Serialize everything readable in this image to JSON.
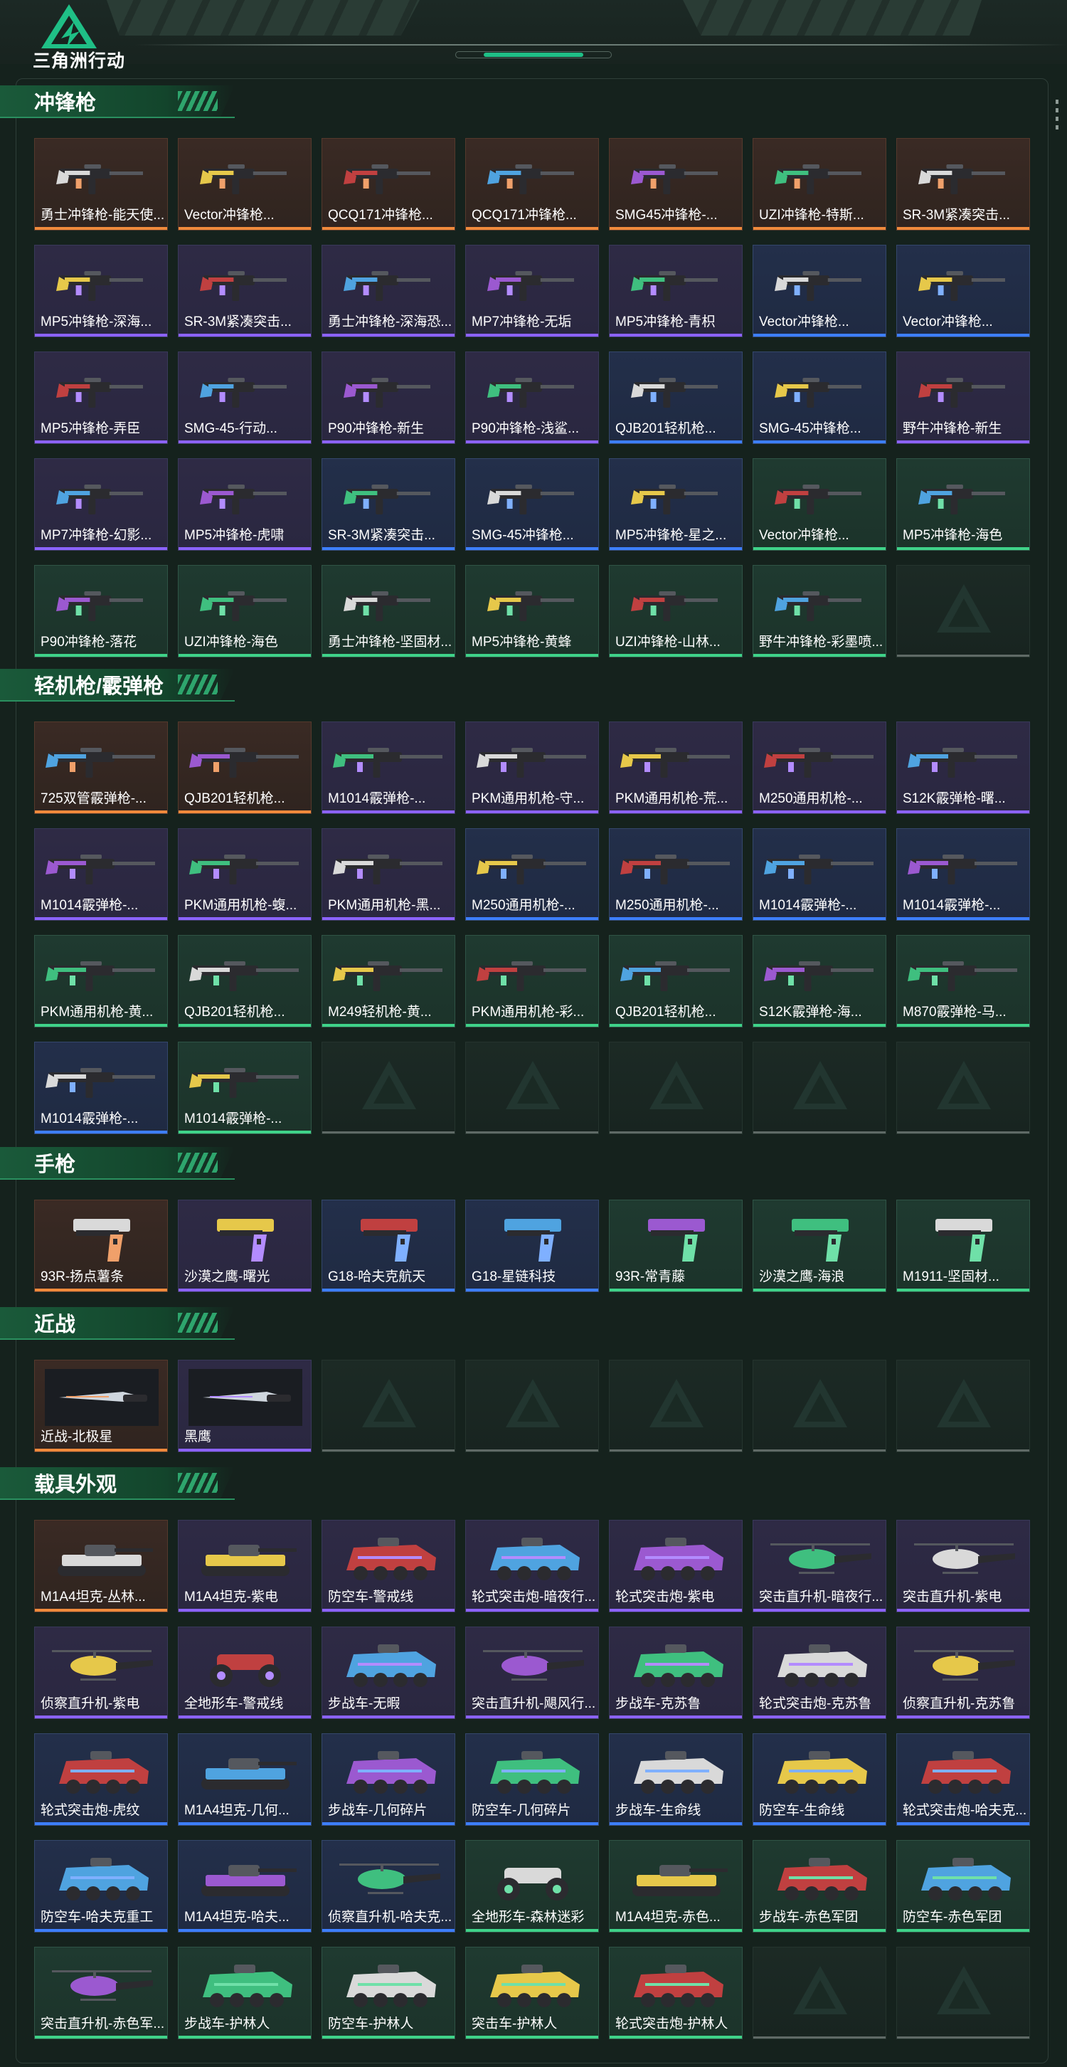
{
  "app": {
    "title": "三角洲行动",
    "logo_icon": "delta-logo-icon"
  },
  "colors": {
    "accent": "#1fbf86",
    "quality_orange": "#f08a3c",
    "quality_purple": "#8c63ff",
    "quality_blue": "#3d7fff",
    "quality_green": "#3fd389"
  },
  "sections": [
    {
      "title": "冲锋枪",
      "items": [
        {
          "label": "勇士冲锋枪-能天使...",
          "quality": "orange",
          "icon": "smg-icon"
        },
        {
          "label": "Vector冲锋枪...",
          "quality": "orange",
          "icon": "smg-icon"
        },
        {
          "label": "QCQ171冲锋枪...",
          "quality": "orange",
          "icon": "smg-icon"
        },
        {
          "label": "QCQ171冲锋枪...",
          "quality": "orange",
          "icon": "smg-icon"
        },
        {
          "label": "SMG45冲锋枪-...",
          "quality": "orange",
          "icon": "smg-icon"
        },
        {
          "label": "UZI冲锋枪-特斯...",
          "quality": "orange",
          "icon": "smg-icon"
        },
        {
          "label": "SR-3M紧凑突击...",
          "quality": "orange",
          "icon": "smg-icon"
        },
        {
          "label": "MP5冲锋枪-深海...",
          "quality": "purple",
          "icon": "smg-icon"
        },
        {
          "label": "SR-3M紧凑突击...",
          "quality": "purple",
          "icon": "smg-icon"
        },
        {
          "label": "勇士冲锋枪-深海恐...",
          "quality": "purple",
          "icon": "smg-icon"
        },
        {
          "label": "MP7冲锋枪-无垢",
          "quality": "purple",
          "icon": "smg-icon"
        },
        {
          "label": "MP5冲锋枪-青枳",
          "quality": "purple",
          "icon": "smg-icon"
        },
        {
          "label": "Vector冲锋枪...",
          "quality": "blue",
          "icon": "smg-icon"
        },
        {
          "label": "Vector冲锋枪...",
          "quality": "blue",
          "icon": "smg-icon"
        },
        {
          "label": "MP5冲锋枪-弄臣",
          "quality": "purple",
          "icon": "smg-icon"
        },
        {
          "label": "SMG-45-行动...",
          "quality": "purple",
          "icon": "smg-icon"
        },
        {
          "label": "P90冲锋枪-新生",
          "quality": "purple",
          "icon": "smg-icon"
        },
        {
          "label": "P90冲锋枪-浅鲨...",
          "quality": "purple",
          "icon": "smg-icon"
        },
        {
          "label": "QJB201轻机枪...",
          "quality": "blue",
          "icon": "smg-icon"
        },
        {
          "label": "SMG-45冲锋枪...",
          "quality": "blue",
          "icon": "smg-icon"
        },
        {
          "label": "野牛冲锋枪-新生",
          "quality": "purple",
          "icon": "smg-icon"
        },
        {
          "label": "MP7冲锋枪-幻影...",
          "quality": "purple",
          "icon": "smg-icon"
        },
        {
          "label": "MP5冲锋枪-虎啸",
          "quality": "purple",
          "icon": "smg-icon"
        },
        {
          "label": "SR-3M紧凑突击...",
          "quality": "blue",
          "icon": "smg-icon"
        },
        {
          "label": "SMG-45冲锋枪...",
          "quality": "blue",
          "icon": "smg-icon"
        },
        {
          "label": "MP5冲锋枪-星之...",
          "quality": "blue",
          "icon": "smg-icon"
        },
        {
          "label": "Vector冲锋枪...",
          "quality": "green",
          "icon": "smg-icon"
        },
        {
          "label": "MP5冲锋枪-海色",
          "quality": "green",
          "icon": "smg-icon"
        },
        {
          "label": "P90冲锋枪-落花",
          "quality": "green",
          "icon": "smg-icon"
        },
        {
          "label": "UZI冲锋枪-海色",
          "quality": "green",
          "icon": "smg-icon"
        },
        {
          "label": "勇士冲锋枪-坚固材...",
          "quality": "green",
          "icon": "smg-icon"
        },
        {
          "label": "MP5冲锋枪-黄蜂",
          "quality": "green",
          "icon": "smg-icon"
        },
        {
          "label": "UZI冲锋枪-山林...",
          "quality": "green",
          "icon": "smg-icon"
        },
        {
          "label": "野牛冲锋枪-彩墨喷...",
          "quality": "green",
          "icon": "smg-icon"
        }
      ],
      "empty_slots": 1
    },
    {
      "title": "轻机枪/霰弹枪",
      "items": [
        {
          "label": "725双管霰弹枪-...",
          "quality": "orange",
          "icon": "shotgun-icon"
        },
        {
          "label": "QJB201轻机枪...",
          "quality": "orange",
          "icon": "lmg-icon"
        },
        {
          "label": "M1014霰弹枪-...",
          "quality": "purple",
          "icon": "shotgun-icon"
        },
        {
          "label": "PKM通用机枪-守...",
          "quality": "purple",
          "icon": "lmg-icon"
        },
        {
          "label": "PKM通用机枪-荒...",
          "quality": "purple",
          "icon": "lmg-icon"
        },
        {
          "label": "M250通用机枪-...",
          "quality": "purple",
          "icon": "lmg-icon"
        },
        {
          "label": "S12K霰弹枪-曙...",
          "quality": "purple",
          "icon": "shotgun-icon"
        },
        {
          "label": "M1014霰弹枪-...",
          "quality": "purple",
          "icon": "shotgun-icon"
        },
        {
          "label": "PKM通用机枪-蝮...",
          "quality": "purple",
          "icon": "lmg-icon"
        },
        {
          "label": "PKM通用机枪-黑...",
          "quality": "purple",
          "icon": "lmg-icon"
        },
        {
          "label": "M250通用机枪-...",
          "quality": "blue",
          "icon": "lmg-icon"
        },
        {
          "label": "M250通用机枪-...",
          "quality": "blue",
          "icon": "lmg-icon"
        },
        {
          "label": "M1014霰弹枪-...",
          "quality": "blue",
          "icon": "shotgun-icon"
        },
        {
          "label": "M1014霰弹枪-...",
          "quality": "blue",
          "icon": "shotgun-icon"
        },
        {
          "label": "PKM通用机枪-黄...",
          "quality": "green",
          "icon": "lmg-icon"
        },
        {
          "label": "QJB201轻机枪...",
          "quality": "green",
          "icon": "lmg-icon"
        },
        {
          "label": "M249轻机枪-黄...",
          "quality": "green",
          "icon": "lmg-icon"
        },
        {
          "label": "PKM通用机枪-彩...",
          "quality": "green",
          "icon": "lmg-icon"
        },
        {
          "label": "QJB201轻机枪...",
          "quality": "green",
          "icon": "lmg-icon"
        },
        {
          "label": "S12K霰弹枪-海...",
          "quality": "green",
          "icon": "shotgun-icon"
        },
        {
          "label": "M870霰弹枪-马...",
          "quality": "green",
          "icon": "shotgun-icon"
        },
        {
          "label": "M1014霰弹枪-...",
          "quality": "blue",
          "icon": "shotgun-icon"
        },
        {
          "label": "M1014霰弹枪-...",
          "quality": "green",
          "icon": "shotgun-icon"
        }
      ],
      "empty_slots": 5
    },
    {
      "title": "手枪",
      "items": [
        {
          "label": "93R-扬点薯条",
          "quality": "orange",
          "icon": "pistol-icon"
        },
        {
          "label": "沙漠之鹰-曙光",
          "quality": "purple",
          "icon": "pistol-icon"
        },
        {
          "label": "G18-哈夫克航天",
          "quality": "blue",
          "icon": "pistol-icon"
        },
        {
          "label": "G18-星链科技",
          "quality": "blue",
          "icon": "pistol-icon"
        },
        {
          "label": "93R-常青藤",
          "quality": "green",
          "icon": "pistol-icon"
        },
        {
          "label": "沙漠之鹰-海浪",
          "quality": "green",
          "icon": "pistol-icon"
        },
        {
          "label": "M1911-坚固材...",
          "quality": "green",
          "icon": "pistol-icon"
        }
      ],
      "empty_slots": 0
    },
    {
      "title": "近战",
      "items": [
        {
          "label": "近战-北极星",
          "quality": "orange",
          "icon": "knife-icon"
        },
        {
          "label": "黑鹰",
          "quality": "purple",
          "icon": "knife-icon"
        }
      ],
      "empty_slots": 5
    },
    {
      "title": "载具外观",
      "items": [
        {
          "label": "M1A4坦克-丛林...",
          "quality": "orange",
          "icon": "tank-icon"
        },
        {
          "label": "M1A4坦克-紫电",
          "quality": "purple",
          "icon": "tank-icon"
        },
        {
          "label": "防空车-警戒线",
          "quality": "purple",
          "icon": "apc-icon"
        },
        {
          "label": "轮式突击炮-暗夜行...",
          "quality": "purple",
          "icon": "apc-icon"
        },
        {
          "label": "轮式突击炮-紫电",
          "quality": "purple",
          "icon": "apc-icon"
        },
        {
          "label": "突击直升机-暗夜行...",
          "quality": "purple",
          "icon": "helicopter-icon"
        },
        {
          "label": "突击直升机-紫电",
          "quality": "purple",
          "icon": "helicopter-icon"
        },
        {
          "label": "侦察直升机-紫电",
          "quality": "purple",
          "icon": "helicopter-icon"
        },
        {
          "label": "全地形车-警戒线",
          "quality": "purple",
          "icon": "atv-icon"
        },
        {
          "label": "步战车-无暇",
          "quality": "purple",
          "icon": "apc-icon"
        },
        {
          "label": "突击直升机-飓风行...",
          "quality": "purple",
          "icon": "helicopter-icon"
        },
        {
          "label": "步战车-克苏鲁",
          "quality": "purple",
          "icon": "apc-icon"
        },
        {
          "label": "轮式突击炮-克苏鲁",
          "quality": "purple",
          "icon": "apc-icon"
        },
        {
          "label": "侦察直升机-克苏鲁",
          "quality": "purple",
          "icon": "helicopter-icon"
        },
        {
          "label": "轮式突击炮-虎纹",
          "quality": "blue",
          "icon": "apc-icon"
        },
        {
          "label": "M1A4坦克-几何...",
          "quality": "blue",
          "icon": "tank-icon"
        },
        {
          "label": "步战车-几何碎片",
          "quality": "blue",
          "icon": "apc-icon"
        },
        {
          "label": "防空车-几何碎片",
          "quality": "blue",
          "icon": "apc-icon"
        },
        {
          "label": "步战车-生命线",
          "quality": "blue",
          "icon": "apc-icon"
        },
        {
          "label": "防空车-生命线",
          "quality": "blue",
          "icon": "apc-icon"
        },
        {
          "label": "轮式突击炮-哈夫克...",
          "quality": "blue",
          "icon": "apc-icon"
        },
        {
          "label": "防空车-哈夫克重工",
          "quality": "blue",
          "icon": "apc-icon"
        },
        {
          "label": "M1A4坦克-哈夫...",
          "quality": "blue",
          "icon": "tank-icon"
        },
        {
          "label": "侦察直升机-哈夫克...",
          "quality": "blue",
          "icon": "helicopter-icon"
        },
        {
          "label": "全地形车-森林迷彩",
          "quality": "green",
          "icon": "atv-icon"
        },
        {
          "label": "M1A4坦克-赤色...",
          "quality": "green",
          "icon": "tank-icon"
        },
        {
          "label": "步战车-赤色军团",
          "quality": "green",
          "icon": "apc-icon"
        },
        {
          "label": "防空车-赤色军团",
          "quality": "green",
          "icon": "apc-icon"
        },
        {
          "label": "突击直升机-赤色军...",
          "quality": "green",
          "icon": "helicopter-icon"
        },
        {
          "label": "步战车-护林人",
          "quality": "green",
          "icon": "apc-icon"
        },
        {
          "label": "防空车-护林人",
          "quality": "green",
          "icon": "apc-icon"
        },
        {
          "label": "突击车-护林人",
          "quality": "green",
          "icon": "apc-icon"
        },
        {
          "label": "轮式突击炮-护林人",
          "quality": "green",
          "icon": "apc-icon"
        }
      ],
      "empty_slots": 2
    }
  ]
}
